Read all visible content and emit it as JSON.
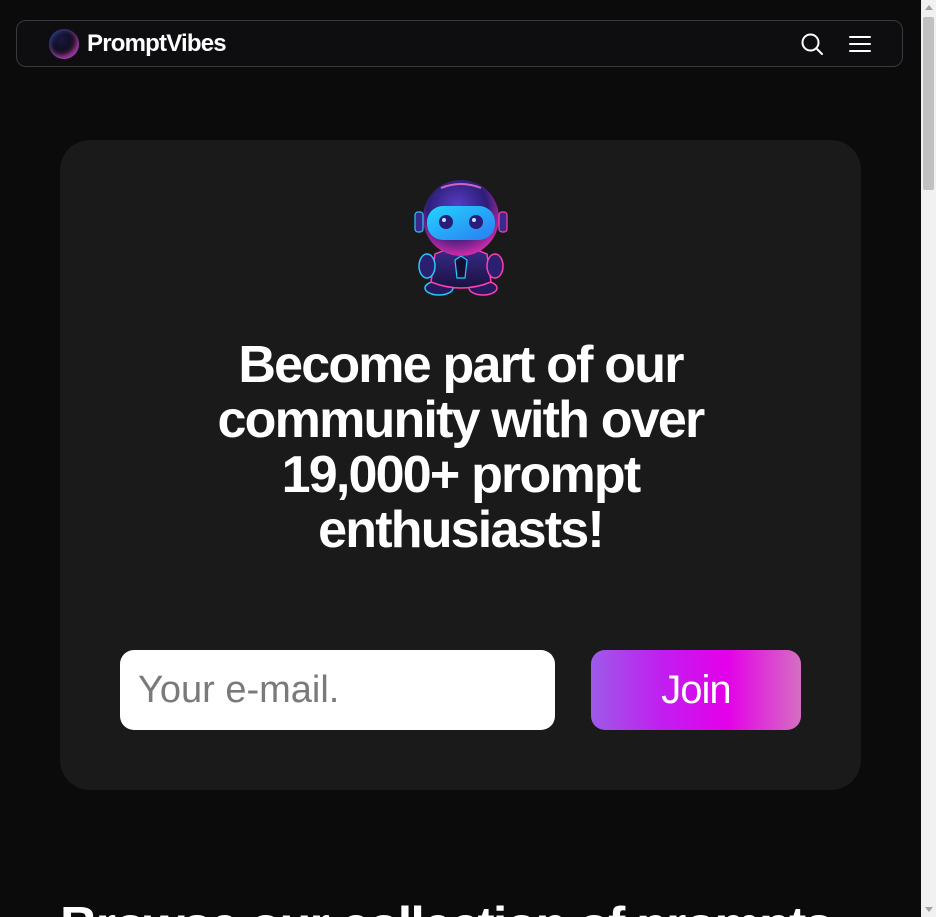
{
  "header": {
    "brand_name": "PromptVibes",
    "search_icon": "search-icon",
    "menu_icon": "hamburger-menu-icon"
  },
  "signup": {
    "illustration": "robot-mascot",
    "headline": "Become part of our community with over 19,000+ prompt enthusiasts!",
    "email_placeholder": "Your e-mail.",
    "email_value": "",
    "join_label": "Join"
  },
  "next_section": {
    "heading": "Browse our collection of prompts"
  },
  "colors": {
    "background": "#0b0b0c",
    "card": "#1a1a1b",
    "join_gradient_start": "#9d5be8",
    "join_gradient_mid": "#e400e9",
    "join_gradient_end": "#d46fc1"
  }
}
